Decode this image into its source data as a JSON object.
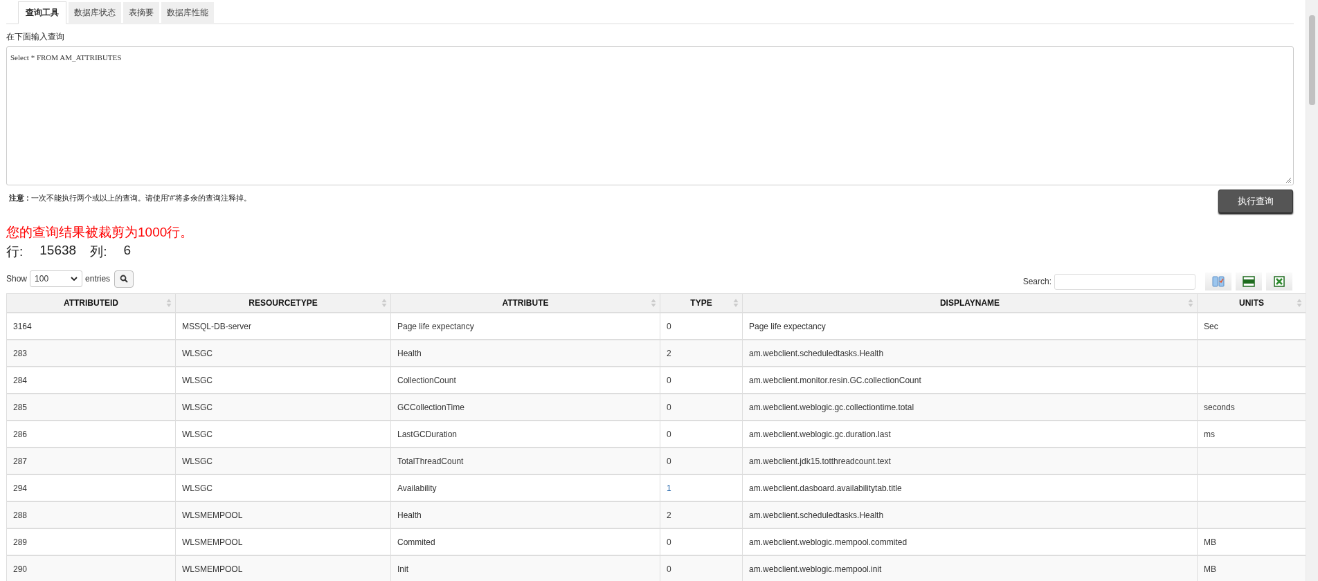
{
  "tabs": [
    {
      "label": "查询工具",
      "selected": true
    },
    {
      "label": "数据库状态",
      "selected": false
    },
    {
      "label": "表摘要",
      "selected": false
    },
    {
      "label": "数据库性能",
      "selected": false
    }
  ],
  "query": {
    "label": "在下面输入查询",
    "value": "Select * FROM AM_ATTRIBUTES"
  },
  "note": "**注意 :** 一次不能执行两个或以上的查询。请使用'#'将多余的查询注释掉。",
  "execute_button": "执行查询",
  "truncated_message": "您的查询结果被裁剪为1000行。",
  "counts": {
    "rows_label": "行:",
    "rows": "15638",
    "cols_label": "列:",
    "cols": "6"
  },
  "show": {
    "before": "Show",
    "value": "100",
    "after": "entries"
  },
  "search": {
    "label": "Search:"
  },
  "table": {
    "columns": [
      "ATTRIBUTEID",
      "RESOURCETYPE",
      "ATTRIBUTE",
      "TYPE",
      "DISPLAYNAME",
      "UNITS"
    ],
    "rows": [
      {
        "attributeid": "3164",
        "resourcetype": "MSSQL-DB-server",
        "attribute": "Page life expectancy",
        "type": "0",
        "type_link": false,
        "displayname": "Page life expectancy",
        "units": "Sec"
      },
      {
        "attributeid": "283",
        "resourcetype": "WLSGC",
        "attribute": "Health",
        "type": "2",
        "type_link": false,
        "displayname": "am.webclient.scheduledtasks.Health",
        "units": ""
      },
      {
        "attributeid": "284",
        "resourcetype": "WLSGC",
        "attribute": "CollectionCount",
        "type": "0",
        "type_link": false,
        "displayname": "am.webclient.monitor.resin.GC.collectionCount",
        "units": ""
      },
      {
        "attributeid": "285",
        "resourcetype": "WLSGC",
        "attribute": "GCCollectionTime",
        "type": "0",
        "type_link": false,
        "displayname": "am.webclient.weblogic.gc.collectiontime.total",
        "units": "seconds"
      },
      {
        "attributeid": "286",
        "resourcetype": "WLSGC",
        "attribute": "LastGCDuration",
        "type": "0",
        "type_link": false,
        "displayname": "am.webclient.weblogic.gc.duration.last",
        "units": "ms"
      },
      {
        "attributeid": "287",
        "resourcetype": "WLSGC",
        "attribute": "TotalThreadCount",
        "type": "0",
        "type_link": false,
        "displayname": "am.webclient.jdk15.totthreadcount.text",
        "units": ""
      },
      {
        "attributeid": "294",
        "resourcetype": "WLSGC",
        "attribute": "Availability",
        "type": "1",
        "type_link": true,
        "displayname": "am.webclient.dasboard.availabilitytab.title",
        "units": ""
      },
      {
        "attributeid": "288",
        "resourcetype": "WLSMEMPOOL",
        "attribute": "Health",
        "type": "2",
        "type_link": false,
        "displayname": "am.webclient.scheduledtasks.Health",
        "units": ""
      },
      {
        "attributeid": "289",
        "resourcetype": "WLSMEMPOOL",
        "attribute": "Commited",
        "type": "0",
        "type_link": false,
        "displayname": "am.webclient.weblogic.mempool.commited",
        "units": "MB"
      },
      {
        "attributeid": "290",
        "resourcetype": "WLSMEMPOOL",
        "attribute": "Init",
        "type": "0",
        "type_link": false,
        "displayname": "am.webclient.weblogic.mempool.init",
        "units": "MB"
      }
    ]
  }
}
